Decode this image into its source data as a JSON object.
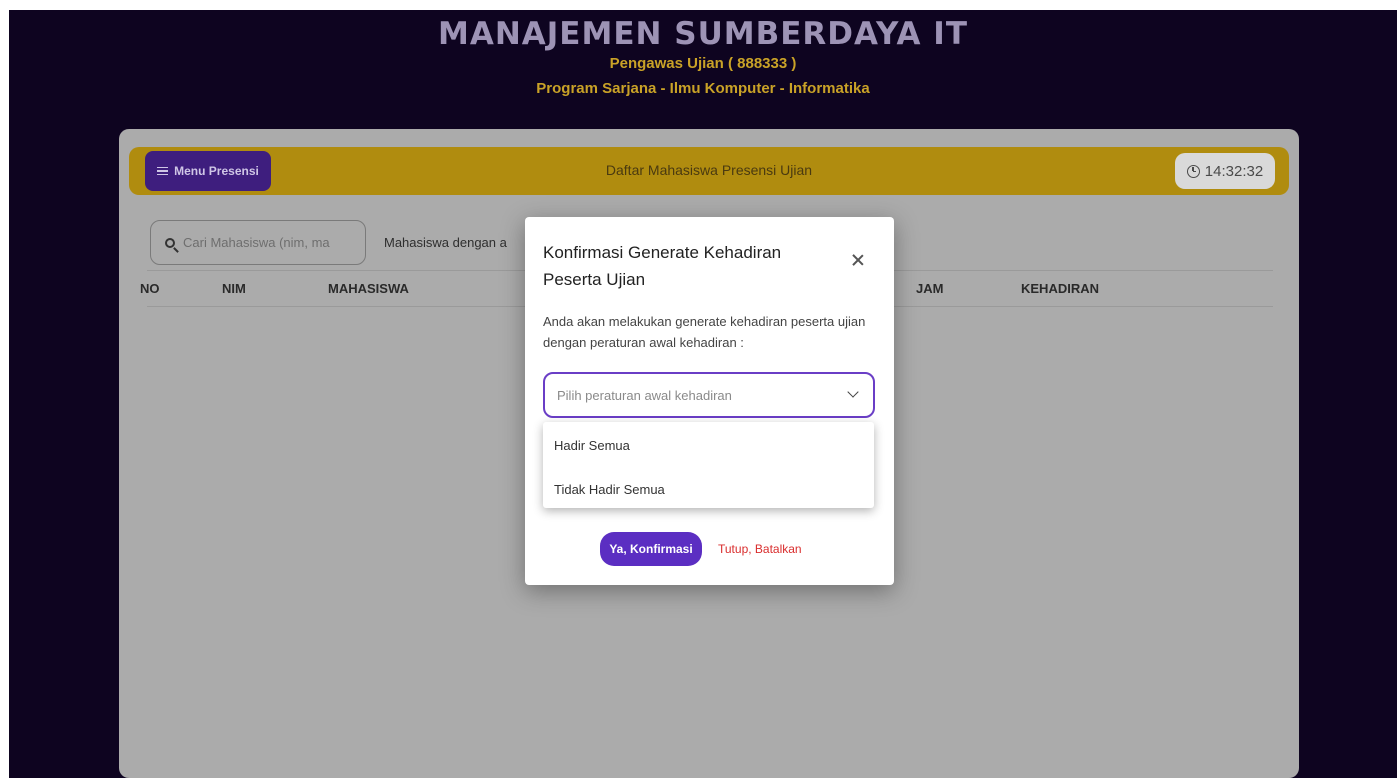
{
  "header": {
    "title": "MANAJEMEN SUMBERDAYA IT",
    "subtitle_line1": "Pengawas Ujian ( 888333 )",
    "subtitle_line2": "Program Sarjana - Ilmu Komputer - Informatika"
  },
  "toolbar": {
    "menu_label": "Menu Presensi",
    "page_title": "Daftar Mahasiswa Presensi Ujian",
    "clock_time": "14:32:32"
  },
  "search": {
    "placeholder": "Cari Mahasiswa (nim, ma"
  },
  "filter_label": "Mahasiswa dengan a",
  "table": {
    "headers": [
      "NO",
      "NIM",
      "MAHASISWA",
      "JAM",
      "KEHADIRAN"
    ]
  },
  "modal": {
    "title": "Konfirmasi Generate Kehadiran Peserta Ujian",
    "text": "Anda akan melakukan generate kehadiran peserta ujian dengan peraturan awal kehadiran :",
    "select_placeholder": "Pilih peraturan awal kehadiran",
    "options": [
      "Hadir Semua",
      "Tidak Hadir Semua"
    ],
    "confirm_label": "Ya, Konfirmasi",
    "cancel_label": "Tutup, Batalkan"
  },
  "colors": {
    "background": "#0e0420",
    "accent_purple": "#5b2ec2",
    "gold": "#c9a227",
    "danger": "#d92d2d"
  }
}
